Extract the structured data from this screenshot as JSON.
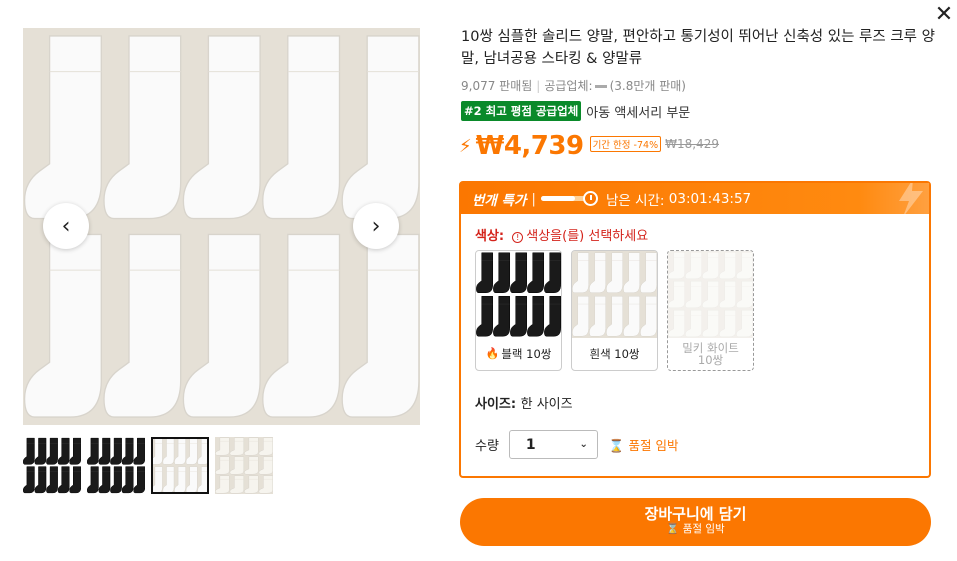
{
  "close_label": "✕",
  "gallery": {
    "prev_icon": "chevron-left-icon",
    "next_icon": "chevron-right-icon",
    "thumbnails": [
      {
        "variant": "black",
        "selected": false
      },
      {
        "variant": "black",
        "selected": false
      },
      {
        "variant": "white",
        "selected": true
      },
      {
        "variant": "milky",
        "selected": false
      }
    ]
  },
  "product": {
    "title": "10쌍 심플한 솔리드 양말, 편안하고 통기성이 뛰어난 신축성 있는 루즈 크루 양말, 남녀공용 스타킹 & 양말류",
    "sold": "9,077 판매됨",
    "supplier_prefix": "공급업체:",
    "supplier_sales": "(3.8만개 판매)",
    "rank_badge": "#2 최고 평점 공급업체",
    "rank_category": "아동 액세서리 부문",
    "price": "₩4,739",
    "discount": "기간 한정 -74%",
    "original_price": "₩18,429"
  },
  "flash": {
    "label": "번개 특가",
    "divider": "|",
    "remaining_prefix": "남은 시간:",
    "remaining_time": "03:01:43:57",
    "progress": 0.75
  },
  "options": {
    "color_label": "색상:",
    "color_warning": "색상을(를) 선택하세요",
    "swatches": [
      {
        "label": "블랙 10쌍",
        "variant": "black",
        "hot": true,
        "disabled": false
      },
      {
        "label": "흰색 10쌍",
        "variant": "white",
        "hot": false,
        "disabled": false
      },
      {
        "label": "밀키 화이트 10쌍",
        "variant": "milky",
        "hot": false,
        "disabled": true
      }
    ],
    "size_label": "사이즈:",
    "size_value": "한 사이즈",
    "qty_label": "수량",
    "qty_value": "1",
    "low_stock": "품절 임박"
  },
  "cart": {
    "label": "장바구니에 담기",
    "sub": "품절 임박"
  },
  "colors": {
    "accent": "#fb7701",
    "badge_green": "#0a8a2a",
    "warning_red": "#d4241c",
    "product_bg": "#e5e0d6"
  }
}
